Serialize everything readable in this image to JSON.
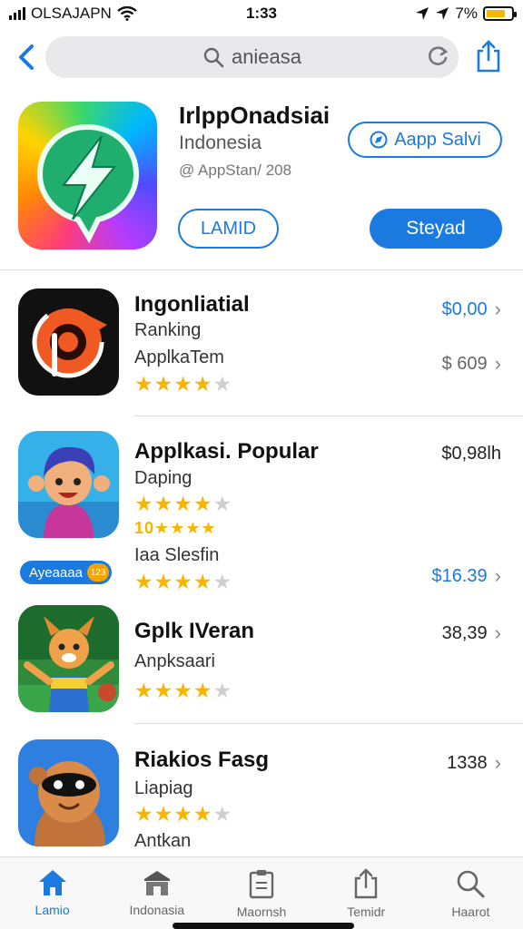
{
  "status_bar": {
    "carrier": "OLSAJAPN",
    "time": "1:33",
    "battery_text": "7%",
    "battery_level": 0.75,
    "battery_color": "#f5b800"
  },
  "search": {
    "query": "anieasa"
  },
  "header_app": {
    "title": "IrlppOnadsiai",
    "subtitle": "Indonesia",
    "meta": "@ AppStan/ 208",
    "app_salvi_label": "Aapp Salvi",
    "lamid_label": "LAMID",
    "steyad_label": "Steyad"
  },
  "list": [
    {
      "title": "Ingonliatial",
      "line1": "Ranking",
      "line2": "ApplkaTem",
      "rating": 4,
      "price_primary": "$0,00",
      "price_secondary": "$ 609"
    },
    {
      "title": "Applkasi. Popular",
      "line1": "Daping",
      "rating": 4,
      "rank_text": "10★★★★",
      "line2": "Iaa Slesfin",
      "rating2": 4,
      "price_primary": "$0,98lh",
      "price_secondary": "$16.39",
      "badge_label": "Ayeaaaa",
      "badge_coin": "123"
    },
    {
      "title": "Gplk IVeran",
      "line1": "Anpksaari",
      "rating": 4,
      "price_primary": "38,39"
    },
    {
      "title": "Riakios Fasg",
      "line1": "Liapiag",
      "line2": "Antkan",
      "rating": 4,
      "price_primary": "1338"
    }
  ],
  "tabbar": [
    {
      "label": "Lamio",
      "icon": "home-icon",
      "active": true
    },
    {
      "label": "Indonasia",
      "icon": "store-icon",
      "active": false
    },
    {
      "label": "Maornsh",
      "icon": "clipboard-icon",
      "active": false
    },
    {
      "label": "Temidr",
      "icon": "share-icon",
      "active": false
    },
    {
      "label": "Haarot",
      "icon": "search-icon",
      "active": false
    }
  ],
  "colors": {
    "accent": "#1a7ae0",
    "star": "#f7b500",
    "star_off": "#cfcfcf"
  }
}
